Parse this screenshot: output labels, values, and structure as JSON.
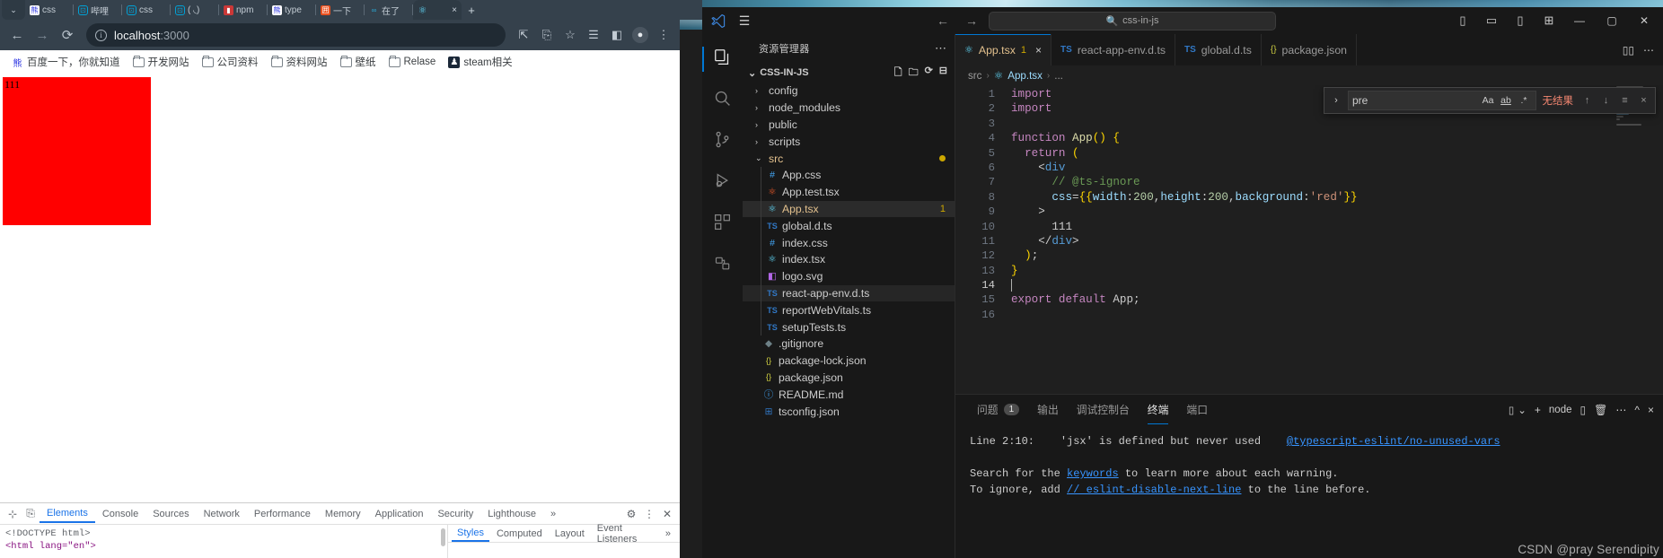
{
  "browser": {
    "tabs": [
      {
        "label": "css",
        "icon": "baidu-icon",
        "color": "#ffffff",
        "active": false
      },
      {
        "label": "哔哩",
        "icon": "bilibili-icon",
        "color": "#00a1d6",
        "active": false
      },
      {
        "label": "css",
        "icon": "bilibili-icon",
        "color": "#00a1d6",
        "active": false
      },
      {
        "label": "( ◟)",
        "icon": "bilibili-icon",
        "color": "#00a1d6",
        "active": false
      },
      {
        "label": "npm",
        "icon": "npm-icon",
        "color": "#cb3837",
        "active": false
      },
      {
        "label": "type",
        "icon": "baidu-icon",
        "color": "#ffffff",
        "active": false
      },
      {
        "label": "一下",
        "icon": "note-icon",
        "color": "#e8501f",
        "active": false
      },
      {
        "label": "在了",
        "icon": "infinity-icon",
        "color": "#2aa9d6",
        "active": false
      },
      {
        "label": "",
        "icon": "react-icon",
        "color": "#61dafb",
        "active": true
      }
    ],
    "new_tab_label": "+",
    "tab_close_label": "×",
    "tab_list_chevron": "⌄",
    "nav": {
      "back": "←",
      "forward": "→",
      "reload": "⟳"
    },
    "omnibox": {
      "info_icon": "i",
      "host": "localhost",
      "port": ":3000"
    },
    "toolbar_icons": [
      "install-app-icon",
      "translate-icon",
      "bookmark-star-icon",
      "reading-list-icon",
      "side-panel-icon",
      "profile-avatar-icon",
      "chrome-menu-icon"
    ],
    "bookmarks": [
      {
        "label": "百度一下，你就知道",
        "icon": "baidu-icon"
      },
      {
        "label": "开发网站",
        "icon": "folder-icon"
      },
      {
        "label": "公司资料",
        "icon": "folder-icon"
      },
      {
        "label": "资料网站",
        "icon": "folder-icon"
      },
      {
        "label": "壁纸",
        "icon": "folder-icon"
      },
      {
        "label": "Relase",
        "icon": "folder-icon"
      },
      {
        "label": "steam相关",
        "icon": "steam-icon"
      }
    ],
    "page": {
      "box_text": "111",
      "box_color": "#ff0000",
      "box_width": "200",
      "box_height": "200"
    }
  },
  "devtools": {
    "left_icons": [
      "inspect-element-icon",
      "device-toolbar-icon"
    ],
    "tabs": [
      "Elements",
      "Console",
      "Sources",
      "Network",
      "Performance",
      "Memory",
      "Application",
      "Security",
      "Lighthouse"
    ],
    "active_tab": "Elements",
    "overflow_label": "»",
    "right_icons": [
      "settings-gear-icon",
      "more-options-icon",
      "close-icon"
    ],
    "dom": {
      "line1": "<!DOCTYPE html>",
      "line2": "<html lang=\"en\">"
    },
    "styles_tabs": [
      "Styles",
      "Computed",
      "Layout",
      "Event Listeners"
    ],
    "styles_active": "Styles",
    "styles_overflow": "»"
  },
  "vscode": {
    "titlebar": {
      "logo": "vscode-logo-icon",
      "menu_icon": "hamburger-menu-icon",
      "back": "←",
      "forward": "→",
      "search_icon": "search-icon",
      "search_text": "css-in-js",
      "layout_icons": [
        "toggle-primary-sidebar-icon",
        "toggle-panel-icon",
        "toggle-secondary-sidebar-icon",
        "customize-layout-icon"
      ],
      "window_buttons": [
        "minimize",
        "maximize",
        "close"
      ]
    },
    "activitybar": [
      {
        "name": "explorer",
        "icon": "files-icon",
        "active": true
      },
      {
        "name": "search",
        "icon": "search-icon",
        "active": false
      },
      {
        "name": "source-control",
        "icon": "source-control-icon",
        "active": false
      },
      {
        "name": "run-and-debug",
        "icon": "debug-icon",
        "active": false
      },
      {
        "name": "extensions",
        "icon": "extensions-icon",
        "active": false
      },
      {
        "name": "remote-explorer",
        "icon": "remote-icon",
        "active": false
      }
    ],
    "sidebar": {
      "title": "资源管理器",
      "more_label": "⋯",
      "root": {
        "label": "CSS-IN-JS",
        "chevron": "⌄"
      },
      "root_actions": [
        "new-file-icon",
        "new-folder-icon",
        "refresh-icon",
        "collapse-all-icon"
      ],
      "tree": [
        {
          "label": "config",
          "type": "folder",
          "chevron": "›",
          "depth": 1
        },
        {
          "label": "node_modules",
          "type": "folder",
          "chevron": "›",
          "depth": 1
        },
        {
          "label": "public",
          "type": "folder",
          "chevron": "›",
          "depth": 1
        },
        {
          "label": "scripts",
          "type": "folder",
          "chevron": "›",
          "depth": 1
        },
        {
          "label": "src",
          "type": "folder-open",
          "chevron": "⌄",
          "depth": 1,
          "modified": true
        },
        {
          "label": "App.css",
          "type": "css",
          "icon": "#",
          "color": "#42a5f5",
          "depth": 2
        },
        {
          "label": "App.test.tsx",
          "type": "react-test",
          "icon": "⚛",
          "color": "#f05a28",
          "depth": 2
        },
        {
          "label": "App.tsx",
          "type": "react",
          "icon": "⚛",
          "color": "#61dafb",
          "depth": 2,
          "selected": true,
          "active_color": "#e2c08d",
          "badge": "1"
        },
        {
          "label": "global.d.ts",
          "type": "ts",
          "icon": "TS",
          "color": "#3178c6",
          "depth": 2
        },
        {
          "label": "index.css",
          "type": "css",
          "icon": "#",
          "color": "#42a5f5",
          "depth": 2
        },
        {
          "label": "index.tsx",
          "type": "react",
          "icon": "⚛",
          "color": "#61dafb",
          "depth": 2
        },
        {
          "label": "logo.svg",
          "type": "svg",
          "icon": "◧",
          "color": "#b267e6",
          "depth": 2
        },
        {
          "label": "react-app-env.d.ts",
          "type": "ts",
          "icon": "TS",
          "color": "#3178c6",
          "depth": 2,
          "highlighted": true
        },
        {
          "label": "reportWebVitals.ts",
          "type": "ts",
          "icon": "TS",
          "color": "#3178c6",
          "depth": 2
        },
        {
          "label": "setupTests.ts",
          "type": "ts",
          "icon": "TS",
          "color": "#3178c6",
          "depth": 2
        },
        {
          "label": ".gitignore",
          "type": "git",
          "icon": "◆",
          "color": "#6d8086",
          "depth": 1
        },
        {
          "label": "package-lock.json",
          "type": "json",
          "icon": "{}",
          "color": "#cbcb41",
          "depth": 1
        },
        {
          "label": "package.json",
          "type": "json",
          "icon": "{}",
          "color": "#cbcb41",
          "depth": 1
        },
        {
          "label": "README.md",
          "type": "md",
          "icon": "ⓘ",
          "color": "#42a5f5",
          "depth": 1
        },
        {
          "label": "tsconfig.json",
          "type": "tsconfig",
          "icon": "⊞",
          "color": "#3178c6",
          "depth": 1
        }
      ]
    },
    "editor": {
      "tabs": [
        {
          "label": "App.tsx",
          "icon": "⚛",
          "color": "#61dafb",
          "active": true,
          "badge": "1",
          "close": "×"
        },
        {
          "label": "react-app-env.d.ts",
          "icon": "TS",
          "color": "#3178c6",
          "active": false
        },
        {
          "label": "global.d.ts",
          "icon": "TS",
          "color": "#3178c6",
          "active": false
        },
        {
          "label": "package.json",
          "icon": "{}",
          "color": "#cbcb41",
          "active": false
        }
      ],
      "tab_actions": [
        "split-editor-icon",
        "more-actions-icon"
      ],
      "breadcrumb": [
        "src",
        "App.tsx",
        "..."
      ],
      "breadcrumb_icon": "react-icon",
      "find": {
        "toggle_replace": "›",
        "query": "pre",
        "match_case": "Aa",
        "whole_word": "ab",
        "regex": ".*",
        "result_text": "无结果",
        "prev": "↑",
        "next": "↓",
        "find_in_selection": "≡",
        "close": "×"
      },
      "code_lines": [
        {
          "n": "1",
          "text": "import"
        },
        {
          "n": "2",
          "text": "import"
        },
        {
          "n": "3",
          "text": ""
        },
        {
          "n": "4",
          "text": "function App() {"
        },
        {
          "n": "5",
          "text": "  return ("
        },
        {
          "n": "6",
          "text": "    <div"
        },
        {
          "n": "7",
          "text": "      // @ts-ignore"
        },
        {
          "n": "8",
          "text": "      css={{width:200,height:200,background:'red'}}"
        },
        {
          "n": "9",
          "text": "    >"
        },
        {
          "n": "10",
          "text": "      111"
        },
        {
          "n": "11",
          "text": "    </div>"
        },
        {
          "n": "12",
          "text": "  );"
        },
        {
          "n": "13",
          "text": "}"
        },
        {
          "n": "14",
          "text": "",
          "current": true
        },
        {
          "n": "15",
          "text": "export default App;"
        },
        {
          "n": "16",
          "text": ""
        }
      ]
    },
    "panel": {
      "tabs": [
        {
          "label": "问题",
          "badge": "1",
          "active": false
        },
        {
          "label": "输出",
          "active": false
        },
        {
          "label": "调试控制台",
          "active": false
        },
        {
          "label": "终端",
          "active": true
        },
        {
          "label": "端口",
          "active": false
        }
      ],
      "actions": {
        "split_terminal": "split-terminal-icon",
        "chevron": "⌄",
        "add_icon": "+",
        "shell_name": "node",
        "new_terminal": "new-terminal-icon",
        "kill": "trash-icon",
        "more": "⋯",
        "maximize": "^",
        "close": "×"
      },
      "terminal": {
        "line1_prefix": "Line 2:10:",
        "line1_msg": "'jsx' is defined but never used",
        "line1_rule": "@typescript-eslint/no-unused-vars",
        "line2_a": "Search for the ",
        "line2_link": "keywords",
        "line2_b": " to learn more about each warning.",
        "line3_a": "To ignore, add ",
        "line3_link": "// eslint-disable-next-line",
        "line3_b": " to the line before."
      }
    }
  },
  "watermark": "CSDN @pray Serendipity"
}
